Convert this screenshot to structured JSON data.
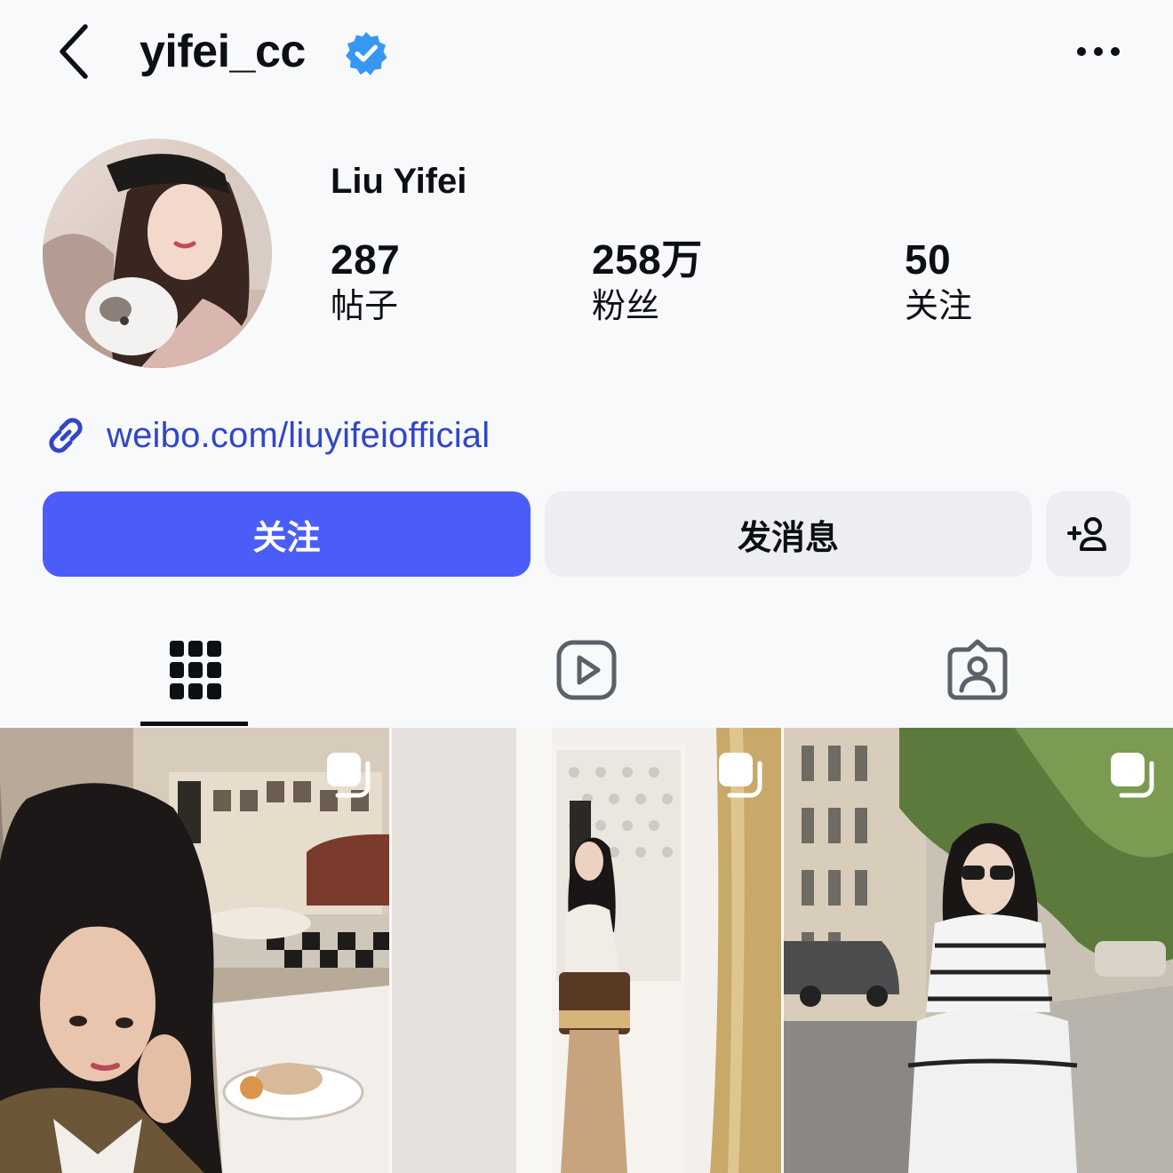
{
  "header": {
    "username": "yifei_cc",
    "verified": true,
    "back_icon": "chevron-left-icon",
    "more_icon": "ellipsis-icon",
    "verified_color": "#3897f0"
  },
  "profile": {
    "display_name": "Liu Yifei",
    "stats": [
      {
        "value": "287",
        "label": "帖子"
      },
      {
        "value": "258万",
        "label": "粉丝"
      },
      {
        "value": "50",
        "label": "关注"
      }
    ],
    "link": "weibo.com/liuyifeiofficial",
    "link_color": "#3146c9"
  },
  "actions": {
    "follow_label": "关注",
    "message_label": "发消息",
    "add_user_icon": "add-user-icon",
    "accent_color": "#4a5df9"
  },
  "tabs": [
    {
      "icon": "grid-icon",
      "active": true
    },
    {
      "icon": "reels-icon",
      "active": false
    },
    {
      "icon": "tagged-icon",
      "active": false
    }
  ],
  "posts": [
    {
      "multi": true
    },
    {
      "multi": true
    },
    {
      "multi": true
    }
  ]
}
